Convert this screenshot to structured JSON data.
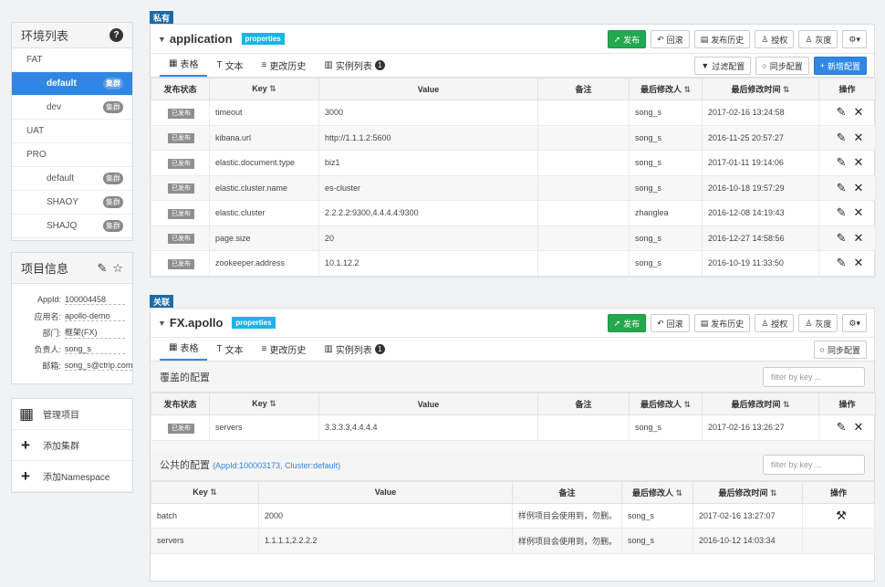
{
  "env_panel": {
    "title": "环境列表",
    "help_icon": "?",
    "items": [
      {
        "label": "FAT",
        "level": 0,
        "badge": ""
      },
      {
        "label": "default",
        "level": 1,
        "badge": "集群",
        "active": true
      },
      {
        "label": "dev",
        "level": 1,
        "badge": "集群"
      },
      {
        "label": "UAT",
        "level": 0,
        "badge": ""
      },
      {
        "label": "PRO",
        "level": 0,
        "badge": ""
      },
      {
        "label": "default",
        "level": 1,
        "badge": "集群"
      },
      {
        "label": "SHAOY",
        "level": 1,
        "badge": "集群"
      },
      {
        "label": "SHAJQ",
        "level": 1,
        "badge": "集群"
      }
    ]
  },
  "project": {
    "title": "项目信息",
    "rows": [
      {
        "key": "AppId:",
        "value": "100004458"
      },
      {
        "key": "应用名:",
        "value": "apollo-demo"
      },
      {
        "key": "部门:",
        "value": "框架(FX)"
      },
      {
        "key": "负责人:",
        "value": "song_s"
      },
      {
        "key": "邮箱:",
        "value": "song_s@ctrip.com"
      }
    ]
  },
  "side_actions": [
    {
      "icon": "grid-icon",
      "glyph": "▦",
      "label": "管理项目"
    },
    {
      "icon": "plus-icon",
      "glyph": "+",
      "label": "添加集群"
    },
    {
      "icon": "plus-icon",
      "glyph": "+",
      "label": "添加Namespace"
    }
  ],
  "toolbar": {
    "publish": "发布",
    "rollback": "回滚",
    "history": "发布历史",
    "grant": "授权",
    "gray": "灰度",
    "settings": "⚙▾"
  },
  "tabs": {
    "table": "表格",
    "text": "文本",
    "history": "更改历史",
    "instances": "实例列表",
    "instance_count": "1"
  },
  "ns1": {
    "tag": "私有",
    "name": "application",
    "format": "properties",
    "tools": {
      "filter": "过滤配置",
      "sync": "同步配置",
      "add": "新增配置"
    },
    "columns": [
      "发布状态",
      "Key",
      "Value",
      "备注",
      "最后修改人",
      "最后修改时间",
      "操作"
    ],
    "rows": [
      {
        "status": "已发布",
        "key": "timeout",
        "value": "3000",
        "comment": "",
        "user": "song_s",
        "time": "2017-02-16 13:24:58"
      },
      {
        "status": "已发布",
        "key": "kibana.url",
        "value": "http://1.1.1.2:5600",
        "comment": "",
        "user": "song_s",
        "time": "2016-11-25 20:57:27"
      },
      {
        "status": "已发布",
        "key": "elastic.document.type",
        "value": "biz1",
        "comment": "",
        "user": "song_s",
        "time": "2017-01-11 19:14:06"
      },
      {
        "status": "已发布",
        "key": "elastic.cluster.name",
        "value": "es-cluster",
        "comment": "",
        "user": "song_s",
        "time": "2016-10-18 19:57:29"
      },
      {
        "status": "已发布",
        "key": "elastic.cluster",
        "value": "2.2.2.2:9300,4.4.4.4:9300",
        "comment": "",
        "user": "zhanglea",
        "time": "2016-12-08 14:19:43"
      },
      {
        "status": "已发布",
        "key": "page.size",
        "value": "20",
        "comment": "",
        "user": "song_s",
        "time": "2016-12-27 14:58:56"
      },
      {
        "status": "已发布",
        "key": "zookeeper.address",
        "value": "10.1.12.2",
        "comment": "",
        "user": "song_s",
        "time": "2016-10-19 11:33:50"
      }
    ]
  },
  "ns2": {
    "tag": "关联",
    "name": "FX.apollo",
    "format": "properties",
    "sync": "同步配置",
    "override": {
      "title": "覆盖的配置",
      "filter_placeholder": "filter by key ...",
      "columns": [
        "发布状态",
        "Key",
        "Value",
        "备注",
        "最后修改人",
        "最后修改时间",
        "操作"
      ],
      "rows": [
        {
          "status": "已发布",
          "key": "servers",
          "value": "3.3.3.3,4.4.4.4",
          "comment": "",
          "user": "song_s",
          "time": "2017-02-16 13:26:27"
        }
      ]
    },
    "public": {
      "title": "公共的配置",
      "source": "(AppId:100003173, Cluster:default)",
      "filter_placeholder": "filter by key ...",
      "columns": [
        "Key",
        "Value",
        "备注",
        "最后修改人",
        "最后修改时间",
        "操作"
      ],
      "rows": [
        {
          "key": "batch",
          "value": "2000",
          "comment": "样例项目会使用到，勿删。",
          "user": "song_s",
          "time": "2017-02-16 13:27:07"
        },
        {
          "key": "servers",
          "value": "1.1.1.1,2.2.2.2",
          "comment": "样例项目会使用到，勿删。",
          "user": "song_s",
          "time": "2016-10-12 14:03:34"
        }
      ]
    }
  }
}
